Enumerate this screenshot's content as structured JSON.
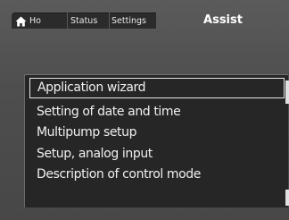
{
  "header": {
    "title": "Assist",
    "tabs": [
      {
        "label": "Ho",
        "icon": "home-icon"
      },
      {
        "label": "Status"
      },
      {
        "label": "Settings"
      }
    ]
  },
  "menu": {
    "items": [
      {
        "label": "Application wizard",
        "selected": true
      },
      {
        "label": "Setting of date and time",
        "selected": false
      },
      {
        "label": "Multipump setup",
        "selected": false
      },
      {
        "label": "Setup, analog input",
        "selected": false
      },
      {
        "label": "Description of control mode",
        "selected": false
      }
    ]
  },
  "colors": {
    "background": "#4e4e4e",
    "panel": "#262626",
    "tab": "#2b2b2b",
    "text": "#f0f0f0",
    "selection_border": "#e6e6e6"
  }
}
